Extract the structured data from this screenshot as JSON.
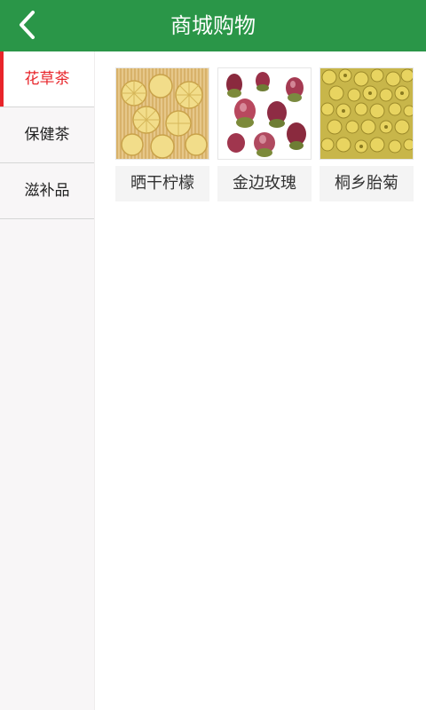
{
  "header": {
    "title": "商城购物",
    "back_icon": "chevron-left-icon"
  },
  "colors": {
    "header_bg": "#2a9648",
    "active_text": "#e8242a",
    "sidebar_bg": "#f8f6f7"
  },
  "sidebar": {
    "items": [
      {
        "label": "花草茶",
        "active": true
      },
      {
        "label": "保健茶",
        "active": false
      },
      {
        "label": "滋补品",
        "active": false
      }
    ]
  },
  "products": [
    {
      "name": "晒干柠檬",
      "image": "dried-lemon-slices-image"
    },
    {
      "name": "金边玫瑰",
      "image": "dried-rose-buds-image"
    },
    {
      "name": "桐乡胎菊",
      "image": "dried-chrysanthemum-image"
    }
  ]
}
